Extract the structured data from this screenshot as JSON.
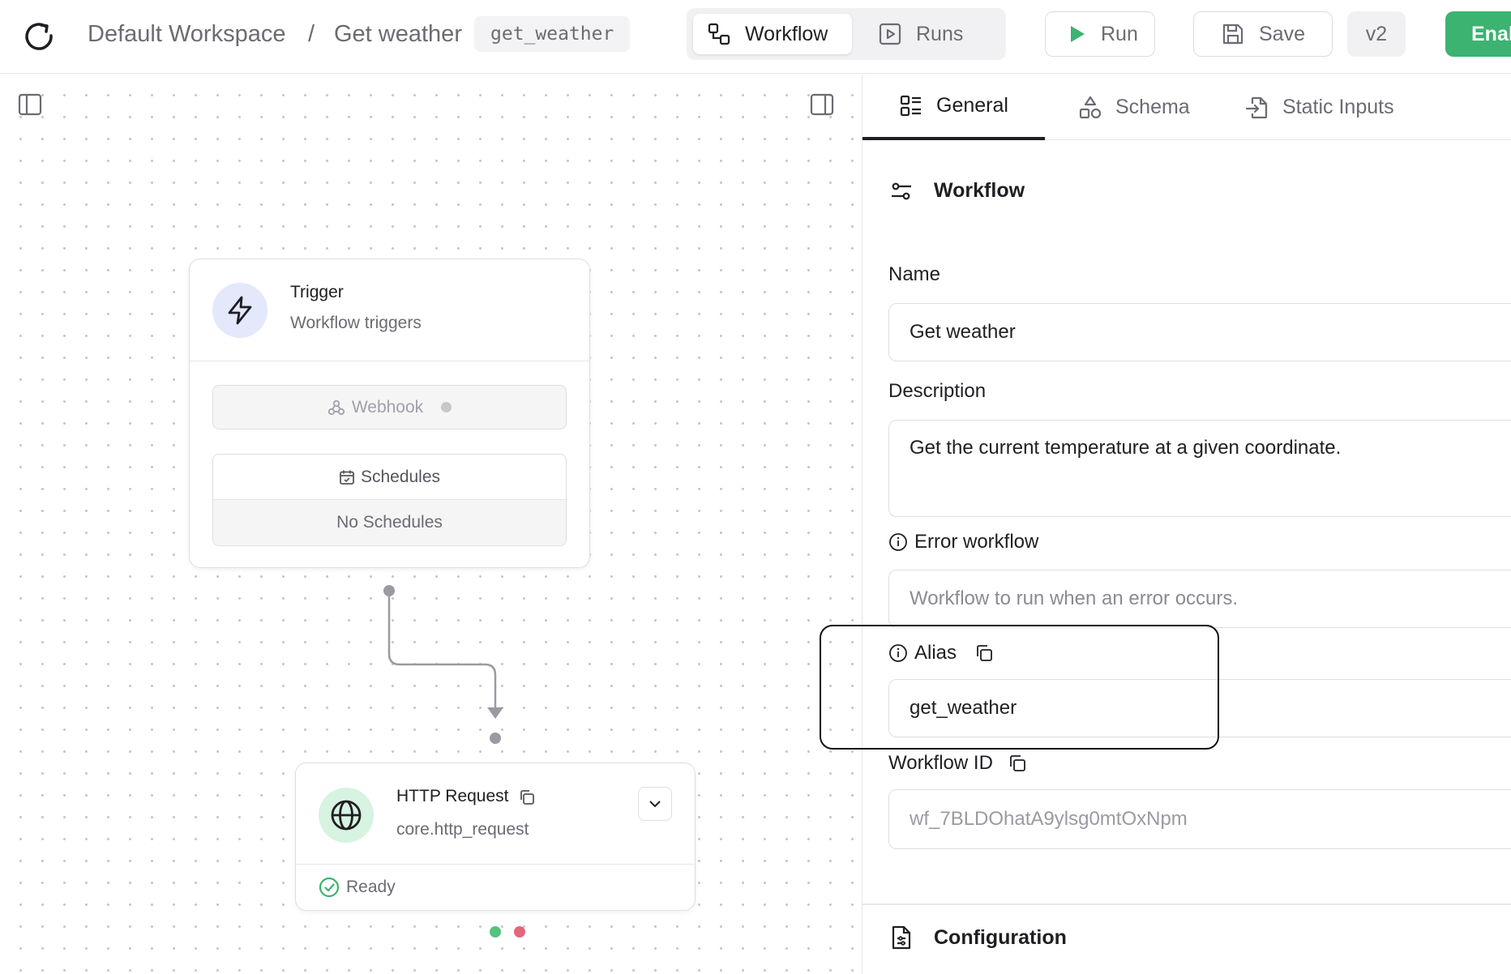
{
  "header": {
    "workspace": "Default Workspace",
    "separator": "/",
    "workflow_title": "Get weather",
    "alias_chip": "get_weather",
    "tabs": {
      "workflow": "Workflow",
      "runs": "Runs"
    },
    "run_label": "Run",
    "save_label": "Save",
    "version": "v2",
    "enable_label": "Enal"
  },
  "canvas": {
    "trigger_node": {
      "title": "Trigger",
      "subtitle": "Workflow triggers",
      "webhook_label": "Webhook",
      "schedules_label": "Schedules",
      "schedules_empty": "No Schedules"
    },
    "http_node": {
      "title": "HTTP Request",
      "subtitle": "core.http_request",
      "status": "Ready"
    }
  },
  "panel": {
    "tabs": {
      "general": "General",
      "schema": "Schema",
      "static_inputs": "Static Inputs"
    },
    "workflow_section": "Workflow",
    "name_label": "Name",
    "name_value": "Get weather",
    "description_label": "Description",
    "description_value": "Get the current temperature at a given coordinate.",
    "error_workflow_label": "Error workflow",
    "error_workflow_placeholder": "Workflow to run when an error occurs.",
    "alias_label": "Alias",
    "alias_value": "get_weather",
    "workflow_id_label": "Workflow ID",
    "workflow_id_value": "wf_7BLDOhatA9ylsg0mtOxNpm",
    "configuration_section": "Configuration"
  },
  "colors": {
    "accent_green": "#3cb371",
    "trigger_icon_bg": "#e4e8fb",
    "http_icon_bg": "#d7f3e1",
    "handle_success": "#52c47e",
    "handle_error": "#e3677a"
  }
}
